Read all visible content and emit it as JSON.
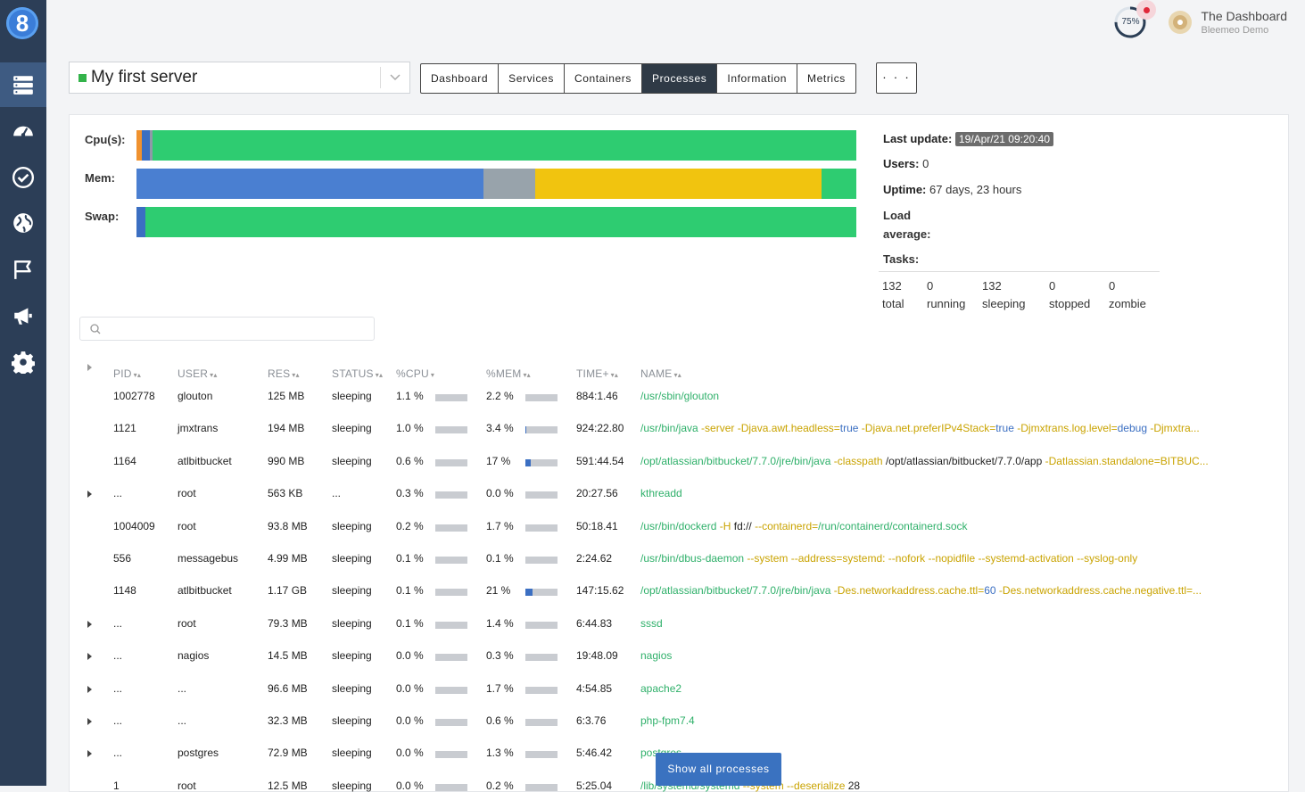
{
  "logo_glyph": "8",
  "header": {
    "gauge_text": "75%",
    "org_name": "The Dashboard",
    "org_sub": "Bleemeo Demo"
  },
  "server": {
    "name": "My first server",
    "status_color": "#33b34a"
  },
  "tabs": [
    "Dashboard",
    "Services",
    "Containers",
    "Processes",
    "Information",
    "Metrics"
  ],
  "active_tab": "Processes",
  "more_label": "· · ·",
  "bars": {
    "cpu_label": "Cpu(s):",
    "mem_label": "Mem:",
    "swap_label": "Swap:",
    "cpu_segments_pct": [
      {
        "color": "#f0922f",
        "pct": 0.7
      },
      {
        "color": "#3b6fc2",
        "pct": 1.2
      },
      {
        "color": "#8f99a8",
        "pct": 0.3
      },
      {
        "color": "#2ecc71",
        "pct": 97.8
      }
    ],
    "mem_segments_pct": [
      {
        "color": "#4a7fd1",
        "pct": 48.2
      },
      {
        "color": "#98a3ab",
        "pct": 7.2
      },
      {
        "color": "#f1c40f",
        "pct": 39.8
      },
      {
        "color": "#2ecc71",
        "pct": 4.8
      }
    ],
    "swap_segments_pct": [
      {
        "color": "#3b6fc2",
        "pct": 1.3
      },
      {
        "color": "#2ecc71",
        "pct": 98.7
      }
    ]
  },
  "info": {
    "last_update_label": "Last update:",
    "last_update_value": "19/Apr/21 09:20:40",
    "users_label": "Users:",
    "users_value": "0",
    "uptime_label": "Uptime:",
    "uptime_value": "67 days, 23 hours",
    "load_label_1": "Load",
    "load_label_2": "average:",
    "tasks_label": "Tasks:",
    "tasks": [
      {
        "value": "132",
        "label": "total"
      },
      {
        "value": "0",
        "label": "running"
      },
      {
        "value": "132",
        "label": "sleeping"
      },
      {
        "value": "0",
        "label": "stopped"
      },
      {
        "value": "0",
        "label": "zombie"
      }
    ]
  },
  "search": {
    "placeholder": ""
  },
  "columns": [
    "PID",
    "USER",
    "RES",
    "STATUS",
    "%CPU",
    "%MEM",
    "TIME+",
    "NAME"
  ],
  "rows": [
    {
      "expand": false,
      "pid": "1002778",
      "user": "glouton",
      "res": "125 MB",
      "status": "sleeping",
      "cpu": "1.1 %",
      "cpu_frac": 0,
      "mem": "2.2 %",
      "mem_frac": 0,
      "time": "884:1.46",
      "cmd": [
        [
          "g",
          "/usr/sbin/glouton"
        ]
      ]
    },
    {
      "expand": false,
      "pid": "1121",
      "user": "jmxtrans",
      "res": "194 MB",
      "status": "sleeping",
      "cpu": "1.0 %",
      "cpu_frac": 0,
      "mem": "3.4 %",
      "mem_frac": 0.03,
      "time": "924:22.80",
      "cmd": [
        [
          "g",
          "/usr/bin/java"
        ],
        [
          "y",
          " -server -Djava.awt.headless="
        ],
        [
          "b",
          "true"
        ],
        [
          "y",
          " -Djava.net.preferIPv4Stack="
        ],
        [
          "b",
          "true"
        ],
        [
          "y",
          " -Djmxtrans.log.level="
        ],
        [
          "b",
          "debug"
        ],
        [
          "y",
          " -Djmxtra..."
        ]
      ]
    },
    {
      "expand": false,
      "pid": "1164",
      "user": "atlbitbucket",
      "res": "990 MB",
      "status": "sleeping",
      "cpu": "0.6 %",
      "cpu_frac": 0,
      "mem": "17 %",
      "mem_frac": 0.17,
      "time": "591:44.54",
      "cmd": [
        [
          "g",
          "/opt/atlassian/bitbucket/7.7.0/jre/bin/java"
        ],
        [
          "y",
          " -classpath "
        ],
        [
          "k",
          "/opt/atlassian/bitbucket/7.7.0/app"
        ],
        [
          "y",
          " -Datlassian.standalone=BITBUC..."
        ]
      ]
    },
    {
      "expand": true,
      "pid": "...",
      "user": "root",
      "res": "563 KB",
      "status": "...",
      "cpu": "0.3 %",
      "cpu_frac": 0,
      "mem": "0.0 %",
      "mem_frac": 0,
      "time": "20:27.56",
      "cmd": [
        [
          "g",
          "kthreadd"
        ]
      ]
    },
    {
      "expand": false,
      "pid": "1004009",
      "user": "root",
      "res": "93.8 MB",
      "status": "sleeping",
      "cpu": "0.2 %",
      "cpu_frac": 0,
      "mem": "1.7 %",
      "mem_frac": 0,
      "time": "50:18.41",
      "cmd": [
        [
          "g",
          "/usr/bin/dockerd"
        ],
        [
          "y",
          " -H "
        ],
        [
          "k",
          "fd://"
        ],
        [
          "y",
          " --containerd="
        ],
        [
          "g",
          "/run/containerd/containerd.sock"
        ]
      ]
    },
    {
      "expand": false,
      "pid": "556",
      "user": "messagebus",
      "res": "4.99 MB",
      "status": "sleeping",
      "cpu": "0.1 %",
      "cpu_frac": 0,
      "mem": "0.1 %",
      "mem_frac": 0,
      "time": "2:24.62",
      "cmd": [
        [
          "g",
          "/usr/bin/dbus-daemon"
        ],
        [
          "y",
          " --system --address=systemd: --nofork --nopidfile --systemd-activation --syslog-only"
        ]
      ]
    },
    {
      "expand": false,
      "pid": "1148",
      "user": "atlbitbucket",
      "res": "1.17 GB",
      "status": "sleeping",
      "cpu": "0.1 %",
      "cpu_frac": 0,
      "mem": "21 %",
      "mem_frac": 0.21,
      "time": "147:15.62",
      "cmd": [
        [
          "g",
          "/opt/atlassian/bitbucket/7.7.0/jre/bin/java"
        ],
        [
          "y",
          " -Des.networkaddress.cache.ttl="
        ],
        [
          "b",
          "60"
        ],
        [
          "y",
          " -Des.networkaddress.cache.negative.ttl=..."
        ]
      ]
    },
    {
      "expand": true,
      "pid": "...",
      "user": "root",
      "res": "79.3 MB",
      "status": "sleeping",
      "cpu": "0.1 %",
      "cpu_frac": 0,
      "mem": "1.4 %",
      "mem_frac": 0,
      "time": "6:44.83",
      "cmd": [
        [
          "g",
          "sssd"
        ]
      ]
    },
    {
      "expand": true,
      "pid": "...",
      "user": "nagios",
      "res": "14.5 MB",
      "status": "sleeping",
      "cpu": "0.0 %",
      "cpu_frac": 0,
      "mem": "0.3 %",
      "mem_frac": 0,
      "time": "19:48.09",
      "cmd": [
        [
          "g",
          "nagios"
        ]
      ]
    },
    {
      "expand": true,
      "pid": "...",
      "user": "...",
      "res": "96.6 MB",
      "status": "sleeping",
      "cpu": "0.0 %",
      "cpu_frac": 0,
      "mem": "1.7 %",
      "mem_frac": 0,
      "time": "4:54.85",
      "cmd": [
        [
          "g",
          "apache2"
        ]
      ]
    },
    {
      "expand": true,
      "pid": "...",
      "user": "...",
      "res": "32.3 MB",
      "status": "sleeping",
      "cpu": "0.0 %",
      "cpu_frac": 0,
      "mem": "0.6 %",
      "mem_frac": 0,
      "time": "6:3.76",
      "cmd": [
        [
          "g",
          "php-fpm7.4"
        ]
      ]
    },
    {
      "expand": true,
      "pid": "...",
      "user": "postgres",
      "res": "72.9 MB",
      "status": "sleeping",
      "cpu": "0.0 %",
      "cpu_frac": 0,
      "mem": "1.3 %",
      "mem_frac": 0,
      "time": "5:46.42",
      "cmd": [
        [
          "g",
          "postgres"
        ]
      ]
    },
    {
      "expand": false,
      "pid": "1",
      "user": "root",
      "res": "12.5 MB",
      "status": "sleeping",
      "cpu": "0.0 %",
      "cpu_frac": 0,
      "mem": "0.2 %",
      "mem_frac": 0,
      "time": "5:25.04",
      "cmd": [
        [
          "g",
          "/lib/systemd/systemd"
        ],
        [
          "y",
          " --system --deserialize "
        ],
        [
          "k",
          "28"
        ]
      ]
    }
  ],
  "show_all_label": "Show all processes"
}
